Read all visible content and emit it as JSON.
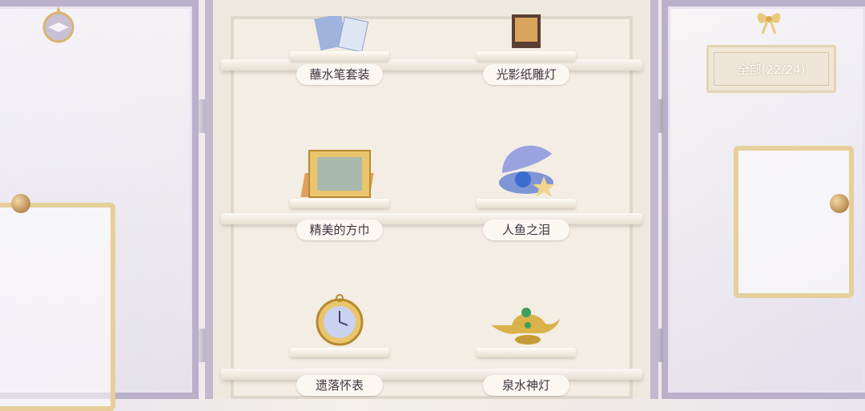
{
  "filter": {
    "label": "全部(22/24)"
  },
  "items": [
    {
      "label": "蘸水笔套装"
    },
    {
      "label": "光影纸雕灯"
    },
    {
      "label": "精美的方巾"
    },
    {
      "label": "人鱼之泪"
    },
    {
      "label": "遗落怀表"
    },
    {
      "label": "泉水神灯"
    }
  ],
  "colors": {
    "label_text": "#3d3441",
    "door_frame": "#b9b0c9",
    "gold_frame": "#e6cf9a"
  },
  "icons": [
    "compass-ornament-icon",
    "bow-icon",
    "fountain-pen-set-icon",
    "paper-carving-lamp-icon",
    "handkerchief-icon",
    "mermaid-tear-shell-icon",
    "pocket-watch-icon",
    "genie-lamp-icon"
  ]
}
